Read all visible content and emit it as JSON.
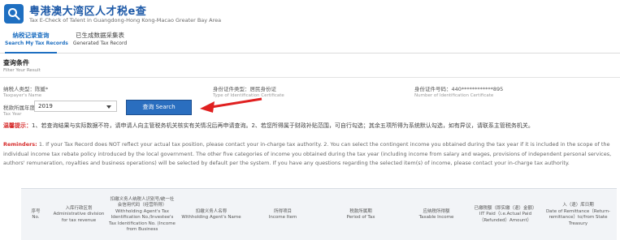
{
  "app": {
    "title": "粤港澳大湾区人才税e查",
    "subtitle": "Tax E-Check of Talent in Guangdong-Hong Kong-Macao Greater Bay Area"
  },
  "tabs": [
    {
      "zh": "纳税记录查询",
      "en": "Search My Tax Records",
      "active": true
    },
    {
      "zh": "已生成数据采集表",
      "en": "Generated Tax Record",
      "active": false
    }
  ],
  "filter": {
    "title_zh": "查询条件",
    "title_en": "Filter Your Result",
    "taxpayer_type": {
      "zh": "纳税人类型：陈媛*",
      "en": "Taxpayer's Name"
    },
    "id_type": {
      "zh": "身份证件类型：居民身份证",
      "en": "Type of Identification Certificate"
    },
    "id_number": {
      "zh": "身份证件号码：440************895",
      "en": "Number of Identification Certificate"
    },
    "tax_year": {
      "zh": "税款所属年度：",
      "en": "Tax Year",
      "value": "2019"
    },
    "search_label": "查询 Search"
  },
  "reminder": {
    "zh_label": "温馨提示：",
    "zh_text": "1、若查询结果与实际数据不符，请申请人向主管税务机关核实有关情况后再申请查询。2、若您所得属于财政补贴范围，可自行勾选；其余五项所得为系统默认勾选，如有异议，请联系主管税务机关。",
    "en_label": "Reminders:",
    "en_text": "1. If your Tax Record does NOT reflect your actual tax position, please contact your in-charge tax authority. 2. You can select the contingent income you obtained during the tax year if it is included in the scope of the individual income tax rebate policy introduced by the local government. The other five categories of income you obtained during the tax year (including income from salary and wages, provisions of independent personal services, authors' remuneration, royalties and business operations) will be selected by default per the system. If you have any questions regarding the selected item(s) of income, please contact your in-charge tax authority."
  },
  "table": {
    "columns": [
      {
        "zh": "序号",
        "en": "No."
      },
      {
        "zh": "入库行政区划",
        "en": "Administrative division for tax revenue"
      },
      {
        "zh": "扣缴义务人纳税人识别号/统一社会信用代码（经营所得）",
        "en": "Withholding Agent's Tax Identification No./Investee's Tax Identification No. (Income from Business"
      },
      {
        "zh": "扣缴义务人名称",
        "en": "Withholding Agent's Name"
      },
      {
        "zh": "所得项目",
        "en": "Income Item"
      },
      {
        "zh": "税款所属期",
        "en": "Period of Tax"
      },
      {
        "zh": "应纳税所得额",
        "en": "Taxable Income"
      },
      {
        "zh": "已缴税额（即实缴（退）金额）",
        "en": "IIT Paid（i.e.Actual Paid（Refunded）Amount）"
      },
      {
        "zh": "入（退）库日期",
        "en": "Date of Remittance（Return-remittance）to/from State Treasury"
      }
    ]
  },
  "colors": {
    "brand_blue": "#1e6fc1",
    "button_blue": "#2a6ebf",
    "reminder_red": "#d62b2b",
    "arrow_red": "#e02020"
  }
}
